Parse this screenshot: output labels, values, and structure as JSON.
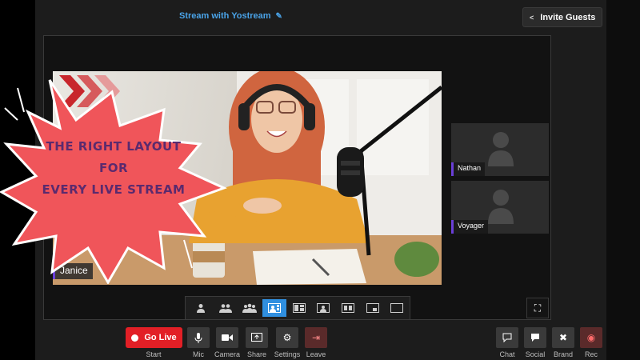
{
  "header": {
    "stream_title": "Stream with Yostream",
    "invite_label": "Invite Guests"
  },
  "promo": {
    "line1": "THE RIGHT LAYOUT",
    "line2": "FOR",
    "line3": "EVERY LIVE STREAM"
  },
  "participants": {
    "main": "Janice",
    "guest1": "Nathan",
    "guest2": "Voyager"
  },
  "layout_buttons": [
    {
      "icon": "single-person-icon"
    },
    {
      "icon": "two-people-icon"
    },
    {
      "icon": "group-icon"
    },
    {
      "icon": "spotlight-layout-icon",
      "active": true
    },
    {
      "icon": "side-by-side-layout-icon"
    },
    {
      "icon": "presenter-layout-icon"
    },
    {
      "icon": "grid-layout-icon"
    },
    {
      "icon": "picture-in-picture-icon"
    },
    {
      "icon": "blank-screen-icon"
    }
  ],
  "controls": {
    "go_live": "Go Live",
    "start": "Start",
    "mic": "Mic",
    "camera": "Camera",
    "share": "Share",
    "settings": "Settings",
    "leave": "Leave",
    "chat": "Chat",
    "social": "Social",
    "brand": "Brand",
    "rec": "Rec"
  },
  "colors": {
    "accent": "#2f8fe0",
    "go_live": "#e21f26",
    "burst": "#f0555a",
    "burst_text": "#5b2a6e",
    "name_tag_bar": "#6a3fd8"
  }
}
